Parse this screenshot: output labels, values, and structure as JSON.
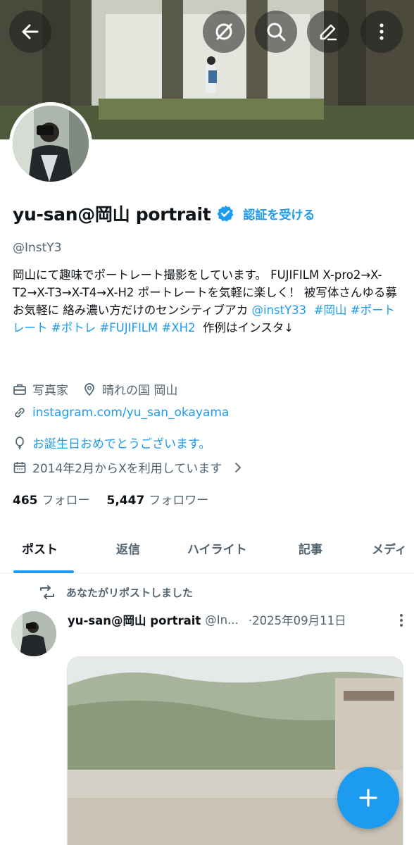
{
  "header": {
    "back_icon": "arrow-left-icon",
    "actions": [
      "grok-icon",
      "search-icon",
      "edit-icon",
      "more-vertical-icon"
    ]
  },
  "profile": {
    "display_name": "yu-san@岡山 portrait",
    "verify_label": "認証を受ける",
    "handle": "@InstY3",
    "bio": {
      "text": "岡山にて趣味でポートレート撮影をしています。 FUJIFILM X-pro2→X-T2→X-T3→X-T4→X-H2 ポートレートを気軽に楽しく！ 被写体さんゆる募 お気軽に 絡み濃い方だけのセンシティブアカ ",
      "mention": "@instY33",
      "tags": [
        "#岡山",
        "#ポートレート",
        "#ポトレ",
        "#FUJIFILM",
        "#XH2"
      ],
      "tail": "作例はインスタ↓"
    },
    "profession": "写真家",
    "location": "晴れの国 岡山",
    "website": "instagram.com/yu_san_okayama",
    "birthday": "お誕生日おめでとうございます。",
    "joined": "2014年2月からXを利用しています",
    "following_count": "465",
    "following_label": "フォロー",
    "followers_count": "5,447",
    "followers_label": "フォロワー"
  },
  "tabs": [
    {
      "label": "ポスト",
      "active": true
    },
    {
      "label": "返信",
      "active": false
    },
    {
      "label": "ハイライト",
      "active": false
    },
    {
      "label": "記事",
      "active": false
    },
    {
      "label": "メディ",
      "active": false
    }
  ],
  "post": {
    "repost_label": "あなたがリポストしました",
    "author_name": "yu-san@岡山 portrait",
    "author_handle": "@In...",
    "date": "·2025年09月11日"
  },
  "colors": {
    "accent": "#1d9bf0",
    "text": "#0f1419",
    "muted": "#536471"
  },
  "fab_icon": "plus-icon"
}
